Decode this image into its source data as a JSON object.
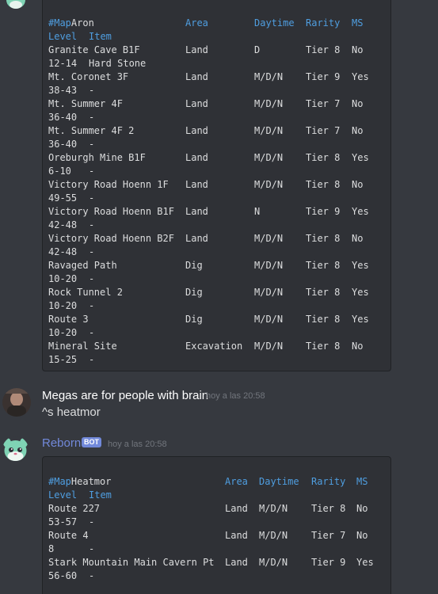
{
  "message1": {
    "title": "Aron",
    "headers": {
      "map": "#Map",
      "area": "Area",
      "daytime": "Daytime",
      "rarity": "Rarity",
      "ms": "MS",
      "level": "Level",
      "item": "Item"
    },
    "rows": [
      {
        "map": "Granite Cave B1F",
        "area": "Land",
        "daytime": "D",
        "rarity": "Tier 8",
        "ms": "No",
        "level": "12-14",
        "item": "Hard Stone"
      },
      {
        "map": "Mt. Coronet 3F",
        "area": "Land",
        "daytime": "M/D/N",
        "rarity": "Tier 9",
        "ms": "Yes",
        "level": "38-43",
        "item": "-"
      },
      {
        "map": "Mt. Summer 4F",
        "area": "Land",
        "daytime": "M/D/N",
        "rarity": "Tier 7",
        "ms": "No",
        "level": "36-40",
        "item": "-"
      },
      {
        "map": "Mt. Summer 4F 2",
        "area": "Land",
        "daytime": "M/D/N",
        "rarity": "Tier 7",
        "ms": "No",
        "level": "36-40",
        "item": "-"
      },
      {
        "map": "Oreburgh Mine B1F",
        "area": "Land",
        "daytime": "M/D/N",
        "rarity": "Tier 8",
        "ms": "Yes",
        "level": "6-10",
        "item": "-"
      },
      {
        "map": "Victory Road Hoenn 1F",
        "area": "Land",
        "daytime": "M/D/N",
        "rarity": "Tier 8",
        "ms": "No",
        "level": "49-55",
        "item": "-"
      },
      {
        "map": "Victory Road Hoenn B1F",
        "area": "Land",
        "daytime": "N",
        "rarity": "Tier 9",
        "ms": "Yes",
        "level": "42-48",
        "item": "-"
      },
      {
        "map": "Victory Road Hoenn B2F",
        "area": "Land",
        "daytime": "M/D/N",
        "rarity": "Tier 8",
        "ms": "No",
        "level": "42-48",
        "item": "-"
      },
      {
        "map": "Ravaged Path",
        "area": "Dig",
        "daytime": "M/D/N",
        "rarity": "Tier 8",
        "ms": "Yes",
        "level": "10-20",
        "item": "-"
      },
      {
        "map": "Rock Tunnel 2",
        "area": "Dig",
        "daytime": "M/D/N",
        "rarity": "Tier 8",
        "ms": "Yes",
        "level": "10-20",
        "item": "-"
      },
      {
        "map": "Route 3",
        "area": "Dig",
        "daytime": "M/D/N",
        "rarity": "Tier 8",
        "ms": "Yes",
        "level": "10-20",
        "item": "-"
      },
      {
        "map": "Mineral Site",
        "area": "Excavation",
        "daytime": "M/D/N",
        "rarity": "Tier 8",
        "ms": "No",
        "level": "15-25",
        "item": "-"
      }
    ]
  },
  "message2": {
    "author": "Megas are for people with brain",
    "timestamp": "hoy a las 20:58",
    "text": "^s heatmor"
  },
  "message3": {
    "author": "Reborn",
    "badge": "BOT",
    "timestamp": "hoy a las 20:58",
    "title": "Heatmor",
    "headers": {
      "map": "#Map",
      "area": "Area",
      "daytime": "Daytime",
      "rarity": "Rarity",
      "ms": "MS",
      "level": "Level",
      "item": "Item"
    },
    "rows": [
      {
        "map": "Route 227",
        "area": "Land",
        "daytime": "M/D/N",
        "rarity": "Tier 8",
        "ms": "No",
        "level": "53-57",
        "item": "-"
      },
      {
        "map": "Route 4",
        "area": "Land",
        "daytime": "M/D/N",
        "rarity": "Tier 7",
        "ms": "No",
        "level": "8",
        "item": "-"
      },
      {
        "map": "Stark Mountain Main Cavern Pt",
        "area": "Land",
        "daytime": "M/D/N",
        "rarity": "Tier 9",
        "ms": "Yes",
        "level": "56-60",
        "item": "-"
      }
    ]
  },
  "colors": {
    "background": "#36393f",
    "codeblock": "#2f3136",
    "header_text": "#4f9ee0",
    "bot_name": "#7289da",
    "user_name": "#ffffff"
  },
  "icons": {
    "bot_avatar": "minccino-bot-avatar-icon",
    "user_avatar": "user-avatar-icon"
  }
}
